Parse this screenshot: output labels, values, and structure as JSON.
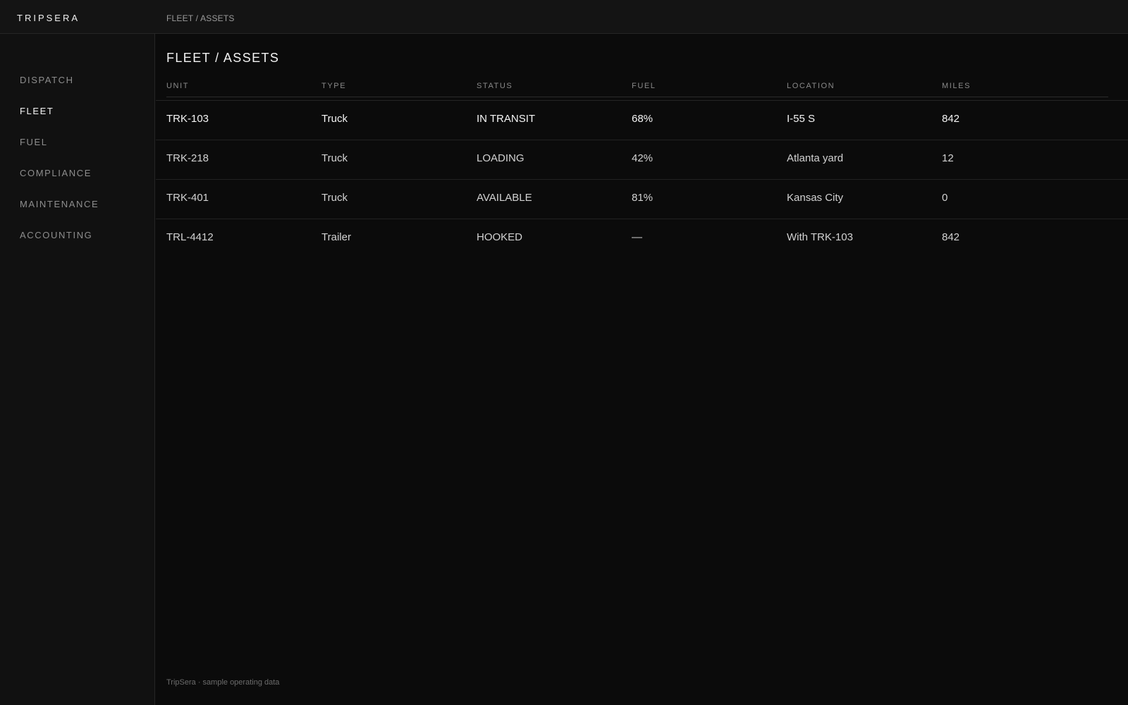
{
  "app": {
    "brand": "TRIPSERA",
    "breadcrumb": "FLEET / ASSETS"
  },
  "sidebar": {
    "items": [
      {
        "label": "DISPATCH",
        "active": false
      },
      {
        "label": "FLEET",
        "active": true
      },
      {
        "label": "FUEL",
        "active": false
      },
      {
        "label": "COMPLIANCE",
        "active": false
      },
      {
        "label": "MAINTENANCE",
        "active": false
      },
      {
        "label": "ACCOUNTING",
        "active": false
      }
    ]
  },
  "main": {
    "title": "FLEET / ASSETS",
    "table": {
      "columns": [
        "UNIT",
        "TYPE",
        "STATUS",
        "FUEL",
        "LOCATION",
        "MILES"
      ],
      "rows": [
        {
          "unit": "TRK-103",
          "type": "Truck",
          "status": "IN TRANSIT",
          "fuel": "68%",
          "location": "I-55 S",
          "miles": "842"
        },
        {
          "unit": "TRK-218",
          "type": "Truck",
          "status": "LOADING",
          "fuel": "42%",
          "location": "Atlanta yard",
          "miles": "12"
        },
        {
          "unit": "TRK-401",
          "type": "Truck",
          "status": "AVAILABLE",
          "fuel": "81%",
          "location": "Kansas City",
          "miles": "0"
        },
        {
          "unit": "TRL-4412",
          "type": "Trailer",
          "status": "HOOKED",
          "fuel": "—",
          "location": "With TRK-103",
          "miles": "842"
        }
      ]
    },
    "footer": "TripSera · sample operating data"
  },
  "colors": {
    "background": "#0b0b0b",
    "sidebar": "#111111",
    "topbar": "#141414",
    "text_primary": "#f4f4f4",
    "text_muted": "#8e8e8e"
  }
}
